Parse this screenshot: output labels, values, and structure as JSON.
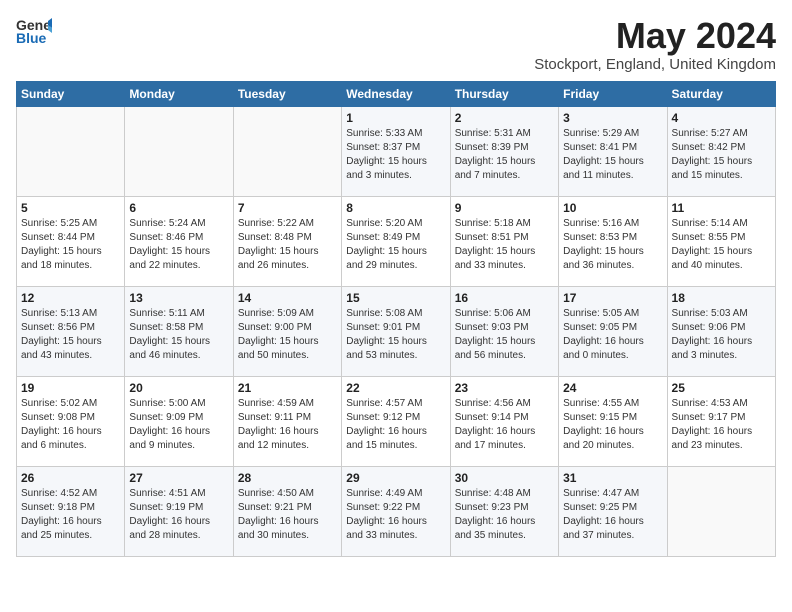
{
  "header": {
    "logo_general": "General",
    "logo_blue": "Blue",
    "title": "May 2024",
    "subtitle": "Stockport, England, United Kingdom"
  },
  "days_of_week": [
    "Sunday",
    "Monday",
    "Tuesday",
    "Wednesday",
    "Thursday",
    "Friday",
    "Saturday"
  ],
  "weeks": [
    [
      {
        "day": "",
        "info": ""
      },
      {
        "day": "",
        "info": ""
      },
      {
        "day": "",
        "info": ""
      },
      {
        "day": "1",
        "info": "Sunrise: 5:33 AM\nSunset: 8:37 PM\nDaylight: 15 hours\nand 3 minutes."
      },
      {
        "day": "2",
        "info": "Sunrise: 5:31 AM\nSunset: 8:39 PM\nDaylight: 15 hours\nand 7 minutes."
      },
      {
        "day": "3",
        "info": "Sunrise: 5:29 AM\nSunset: 8:41 PM\nDaylight: 15 hours\nand 11 minutes."
      },
      {
        "day": "4",
        "info": "Sunrise: 5:27 AM\nSunset: 8:42 PM\nDaylight: 15 hours\nand 15 minutes."
      }
    ],
    [
      {
        "day": "5",
        "info": "Sunrise: 5:25 AM\nSunset: 8:44 PM\nDaylight: 15 hours\nand 18 minutes."
      },
      {
        "day": "6",
        "info": "Sunrise: 5:24 AM\nSunset: 8:46 PM\nDaylight: 15 hours\nand 22 minutes."
      },
      {
        "day": "7",
        "info": "Sunrise: 5:22 AM\nSunset: 8:48 PM\nDaylight: 15 hours\nand 26 minutes."
      },
      {
        "day": "8",
        "info": "Sunrise: 5:20 AM\nSunset: 8:49 PM\nDaylight: 15 hours\nand 29 minutes."
      },
      {
        "day": "9",
        "info": "Sunrise: 5:18 AM\nSunset: 8:51 PM\nDaylight: 15 hours\nand 33 minutes."
      },
      {
        "day": "10",
        "info": "Sunrise: 5:16 AM\nSunset: 8:53 PM\nDaylight: 15 hours\nand 36 minutes."
      },
      {
        "day": "11",
        "info": "Sunrise: 5:14 AM\nSunset: 8:55 PM\nDaylight: 15 hours\nand 40 minutes."
      }
    ],
    [
      {
        "day": "12",
        "info": "Sunrise: 5:13 AM\nSunset: 8:56 PM\nDaylight: 15 hours\nand 43 minutes."
      },
      {
        "day": "13",
        "info": "Sunrise: 5:11 AM\nSunset: 8:58 PM\nDaylight: 15 hours\nand 46 minutes."
      },
      {
        "day": "14",
        "info": "Sunrise: 5:09 AM\nSunset: 9:00 PM\nDaylight: 15 hours\nand 50 minutes."
      },
      {
        "day": "15",
        "info": "Sunrise: 5:08 AM\nSunset: 9:01 PM\nDaylight: 15 hours\nand 53 minutes."
      },
      {
        "day": "16",
        "info": "Sunrise: 5:06 AM\nSunset: 9:03 PM\nDaylight: 15 hours\nand 56 minutes."
      },
      {
        "day": "17",
        "info": "Sunrise: 5:05 AM\nSunset: 9:05 PM\nDaylight: 16 hours\nand 0 minutes."
      },
      {
        "day": "18",
        "info": "Sunrise: 5:03 AM\nSunset: 9:06 PM\nDaylight: 16 hours\nand 3 minutes."
      }
    ],
    [
      {
        "day": "19",
        "info": "Sunrise: 5:02 AM\nSunset: 9:08 PM\nDaylight: 16 hours\nand 6 minutes."
      },
      {
        "day": "20",
        "info": "Sunrise: 5:00 AM\nSunset: 9:09 PM\nDaylight: 16 hours\nand 9 minutes."
      },
      {
        "day": "21",
        "info": "Sunrise: 4:59 AM\nSunset: 9:11 PM\nDaylight: 16 hours\nand 12 minutes."
      },
      {
        "day": "22",
        "info": "Sunrise: 4:57 AM\nSunset: 9:12 PM\nDaylight: 16 hours\nand 15 minutes."
      },
      {
        "day": "23",
        "info": "Sunrise: 4:56 AM\nSunset: 9:14 PM\nDaylight: 16 hours\nand 17 minutes."
      },
      {
        "day": "24",
        "info": "Sunrise: 4:55 AM\nSunset: 9:15 PM\nDaylight: 16 hours\nand 20 minutes."
      },
      {
        "day": "25",
        "info": "Sunrise: 4:53 AM\nSunset: 9:17 PM\nDaylight: 16 hours\nand 23 minutes."
      }
    ],
    [
      {
        "day": "26",
        "info": "Sunrise: 4:52 AM\nSunset: 9:18 PM\nDaylight: 16 hours\nand 25 minutes."
      },
      {
        "day": "27",
        "info": "Sunrise: 4:51 AM\nSunset: 9:19 PM\nDaylight: 16 hours\nand 28 minutes."
      },
      {
        "day": "28",
        "info": "Sunrise: 4:50 AM\nSunset: 9:21 PM\nDaylight: 16 hours\nand 30 minutes."
      },
      {
        "day": "29",
        "info": "Sunrise: 4:49 AM\nSunset: 9:22 PM\nDaylight: 16 hours\nand 33 minutes."
      },
      {
        "day": "30",
        "info": "Sunrise: 4:48 AM\nSunset: 9:23 PM\nDaylight: 16 hours\nand 35 minutes."
      },
      {
        "day": "31",
        "info": "Sunrise: 4:47 AM\nSunset: 9:25 PM\nDaylight: 16 hours\nand 37 minutes."
      },
      {
        "day": "",
        "info": ""
      }
    ]
  ]
}
